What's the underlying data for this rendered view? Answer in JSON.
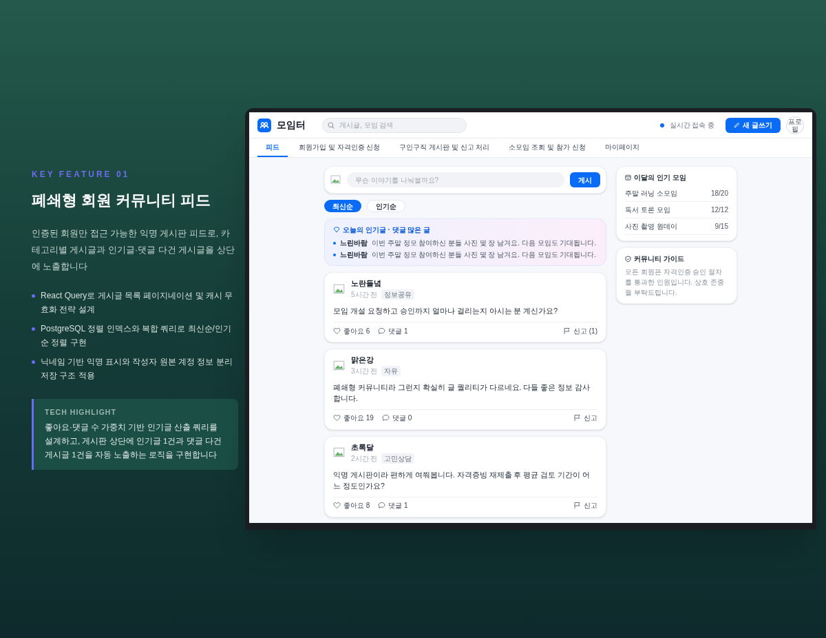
{
  "slide": {
    "eyebrow": "KEY FEATURE 01",
    "title": "폐쇄형 회원 커뮤니티 피드",
    "description": "인증된 회원만 접근 가능한 익명 게시판 피드로, 카테고리별 게시글과 인기글·댓글 다건 게시글을 상단에 노출합니다",
    "bullets": [
      "React Query로 게시글 목록 페이지네이션 및 캐시 무효화 전략 설계",
      "PostgreSQL 정렬 인덱스와 복합 쿼리로 최신순/인기순 정렬 구현",
      "닉네임 기반 익명 표시와 작성자 원본 계정 정보 분리 저장 구조 적용"
    ],
    "highlight": {
      "label": "TECH HIGHLIGHT",
      "text": "좋아요·댓글 수 가중치 기반 인기글 산출 쿼리를 설계하고, 게시판 상단에 인기글 1건과 댓글 다건 게시글 1건을 자동 노출하는 로직을 구현합니다"
    }
  },
  "app": {
    "logo": "모임터",
    "search": {
      "placeholder": "게시글, 모임 검색"
    },
    "status": "실시간 접속 중",
    "new_post_button": "새 글쓰기",
    "avatar_alt": "프로필",
    "tabs": [
      {
        "label": "피드",
        "selected": true
      },
      {
        "label": "회원가입 및 자격인증 신청",
        "selected": false
      },
      {
        "label": "구인구직 게시판 및 신고 처리",
        "selected": false
      },
      {
        "label": "소모임 조회 및 참가 신청",
        "selected": false
      },
      {
        "label": "마이페이지",
        "selected": false
      }
    ],
    "composer": {
      "placeholder": "무슨 이야기를 나눠볼까요?",
      "button": "게시"
    },
    "sort": [
      {
        "label": "최신순",
        "selected": true
      },
      {
        "label": "인기순",
        "selected": false
      }
    ],
    "popular": {
      "title": "오늘의 인기글 · 댓글 많은 글",
      "items": [
        {
          "author": "느린바람",
          "text": "이번 주말 정모 참여하신 분들 사진 몇 장 남겨요. 다음 모임도 기대됩니다."
        },
        {
          "author": "느린바람",
          "text": "이번 주말 정모 참여하신 분들 사진 몇 장 남겨요. 다음 모임도 기대됩니다."
        }
      ]
    },
    "posts": [
      {
        "author": "노란들녘",
        "time": "5시간 전",
        "category": "정보공유",
        "body": "모임 개설 요청하고 승인까지 얼마나 걸리는지 아시는 분 계신가요?",
        "likes": "좋아요 6",
        "comments": "댓글 1",
        "report": "신고 (1)"
      },
      {
        "author": "맑은강",
        "time": "3시간 전",
        "category": "자유",
        "body": "폐쇄형 커뮤니티라 그런지 확실히 글 퀄리티가 다르네요. 다들 좋은 정보 감사합니다.",
        "likes": "좋아요 19",
        "comments": "댓글 0",
        "report": "신고"
      },
      {
        "author": "초록달",
        "time": "2시간 전",
        "category": "고민상담",
        "body": "익명 게시판이라 편하게 여쭤봅니다. 자격증빙 재제출 후 평균 검토 기간이 어느 정도인가요?",
        "likes": "좋아요 8",
        "comments": "댓글 1",
        "report": "신고"
      }
    ],
    "sidebar": {
      "popular_groups": {
        "title": "이달의 인기 모임",
        "groups": [
          {
            "name": "주말 러닝 소모임",
            "count": "18/20"
          },
          {
            "name": "독서 토론 모임",
            "count": "12/12"
          },
          {
            "name": "사진 촬영 원데이",
            "count": "9/15"
          }
        ]
      },
      "guide": {
        "title": "커뮤니티 가이드",
        "text": "모든 회원은 자격인증 승인 절차를 통과한 인원입니다. 상호 존중을 부탁드립니다."
      }
    }
  }
}
